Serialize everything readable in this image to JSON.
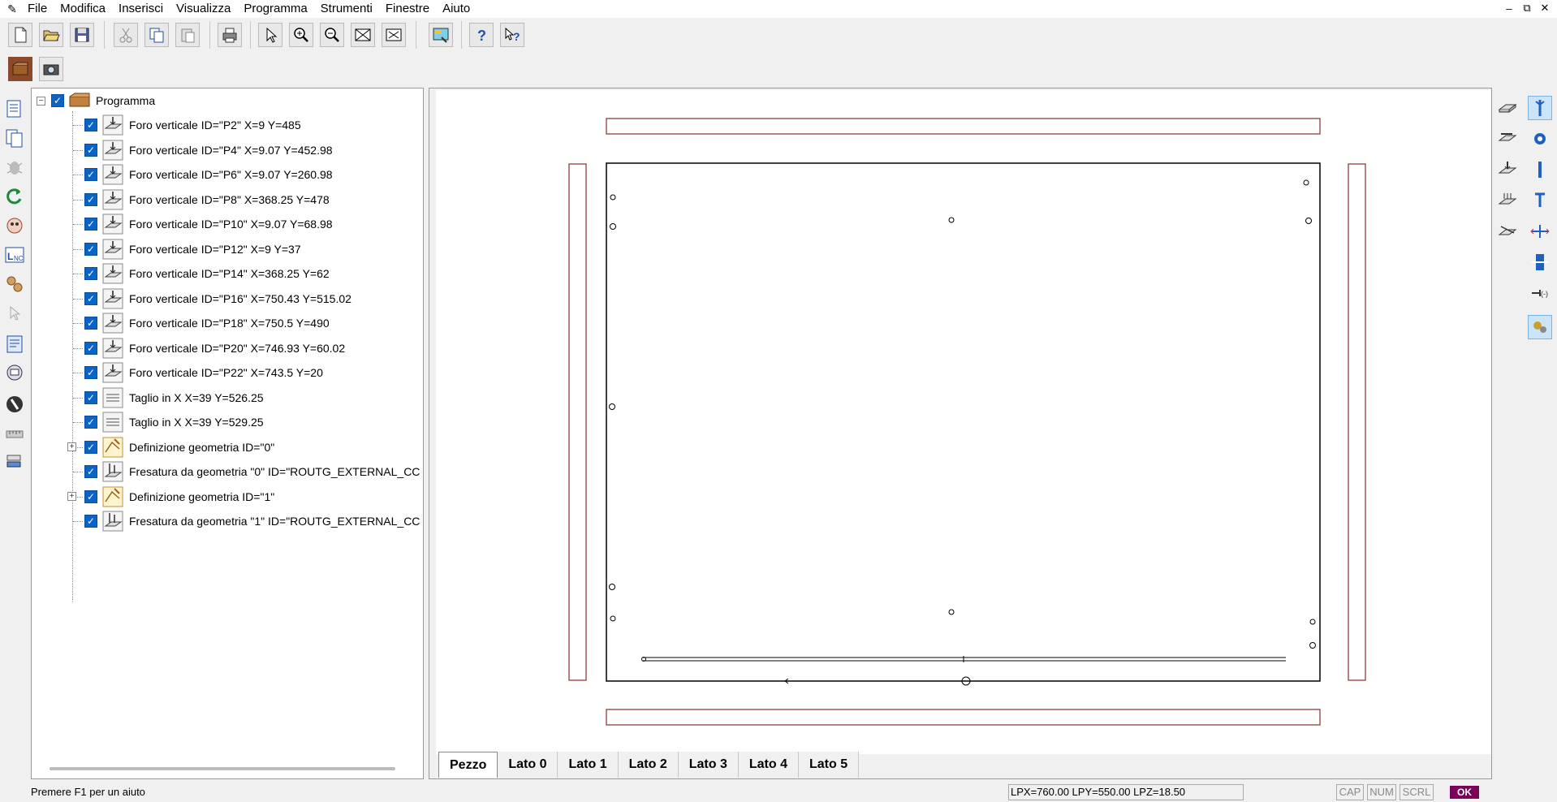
{
  "menu": {
    "items": [
      "File",
      "Modifica",
      "Inserisci",
      "Visualizza",
      "Programma",
      "Strumenti",
      "Finestre",
      "Aiuto"
    ]
  },
  "window_controls": [
    "–",
    "⧉",
    "✕"
  ],
  "tree": {
    "root_label": "Programma",
    "items": [
      {
        "label": "Foro verticale ID=\"P2\" X=9 Y=485",
        "icon": "vertical-drill-icon"
      },
      {
        "label": "Foro verticale ID=\"P4\" X=9.07 Y=452.98",
        "icon": "vertical-drill-icon"
      },
      {
        "label": "Foro verticale ID=\"P6\" X=9.07 Y=260.98",
        "icon": "vertical-drill-icon"
      },
      {
        "label": "Foro verticale ID=\"P8\" X=368.25 Y=478",
        "icon": "vertical-drill-icon"
      },
      {
        "label": "Foro verticale ID=\"P10\" X=9.07 Y=68.98",
        "icon": "vertical-drill-icon"
      },
      {
        "label": "Foro verticale ID=\"P12\" X=9 Y=37",
        "icon": "vertical-drill-icon"
      },
      {
        "label": "Foro verticale ID=\"P14\" X=368.25 Y=62",
        "icon": "vertical-drill-icon"
      },
      {
        "label": "Foro verticale ID=\"P16\" X=750.43 Y=515.02",
        "icon": "vertical-drill-icon"
      },
      {
        "label": "Foro verticale ID=\"P18\" X=750.5 Y=490",
        "icon": "vertical-drill-icon"
      },
      {
        "label": "Foro verticale ID=\"P20\" X=746.93 Y=60.02",
        "icon": "vertical-drill-icon"
      },
      {
        "label": "Foro verticale ID=\"P22\" X=743.5 Y=20",
        "icon": "vertical-drill-icon"
      },
      {
        "label": "Taglio in X X=39 Y=526.25",
        "icon": "saw-cut-icon"
      },
      {
        "label": "Taglio in X X=39 Y=529.25",
        "icon": "saw-cut-icon"
      },
      {
        "label": "Definizione geometria ID=\"0\"",
        "icon": "geometry-icon",
        "expandable": true
      },
      {
        "label": "Fresatura da geometria \"0\" ID=\"ROUTG_EXTERNAL_CC",
        "icon": "routing-icon"
      },
      {
        "label": "Definizione geometria ID=\"1\"",
        "icon": "geometry-icon",
        "expandable": true
      },
      {
        "label": "Fresatura da geometria \"1\" ID=\"ROUTG_EXTERNAL_CC",
        "icon": "routing-icon"
      }
    ]
  },
  "tabs": [
    "Pezzo",
    "Lato 0",
    "Lato 1",
    "Lato 2",
    "Lato 3",
    "Lato 4",
    "Lato 5"
  ],
  "active_tab": "Pezzo",
  "status": {
    "help": "Premere F1 per un aiuto",
    "coords": "LPX=760.00  LPY=550.00  LPZ=18.50",
    "cap": "CAP",
    "num": "NUM",
    "scrl": "SCRL",
    "ok": "OK"
  },
  "colors": {
    "check": "#0a64c8",
    "panel_outline": "#8b2a2a",
    "ok_badge": "#7a005a"
  }
}
